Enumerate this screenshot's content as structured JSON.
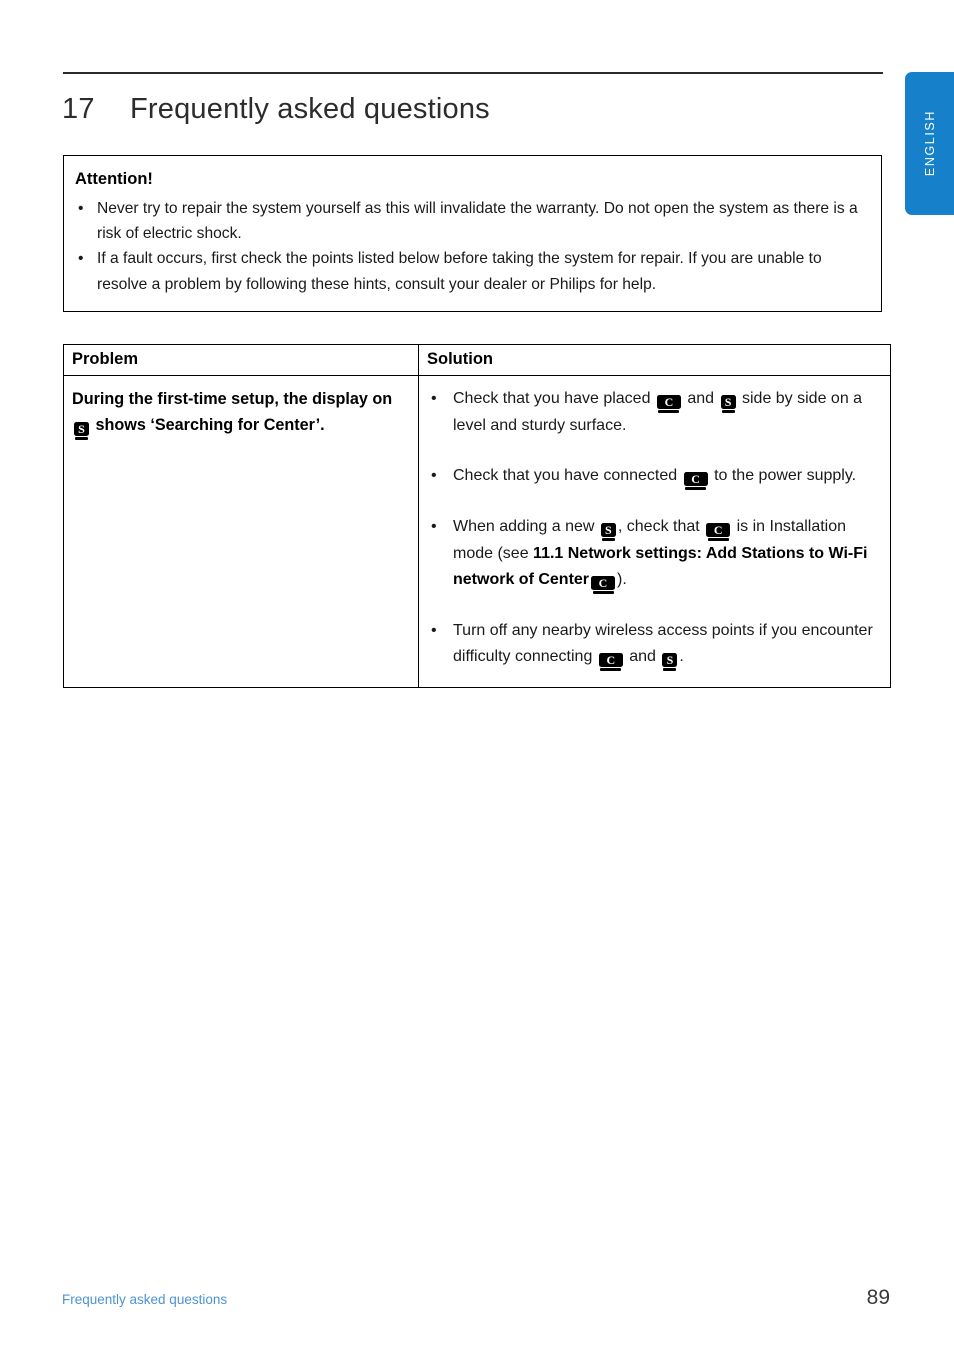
{
  "language_tab": {
    "label": "ENGLISH",
    "color": "#1680cb"
  },
  "chapter": {
    "number": "17",
    "title": "Frequently asked questions"
  },
  "attention": {
    "title": "Attention!",
    "bullet_marker": "•",
    "items": [
      "Never try to repair the system yourself as this will invalidate the warranty. Do not open the system as there is a risk of electric shock.",
      "If a fault occurs, first check the points listed below before taking the system for repair. If you are unable to resolve a problem by following these hints, consult your dealer or Philips for help."
    ]
  },
  "table": {
    "headers": {
      "problem": "Problem",
      "solution": "Solution"
    },
    "row": {
      "problem": {
        "part1": "During the first-time setup, the display on",
        "icon": "S",
        "part2": "shows ‘Searching for Center’."
      },
      "bullet_marker": "•",
      "solutions": [
        {
          "t1": "Check that you have placed",
          "i1": "C",
          "t2": "and",
          "i2": "S",
          "t3": "side by side on a level and sturdy surface."
        },
        {
          "t1": "Check that you have connected",
          "i1": "C",
          "t2": "to the power supply.",
          "i2": "",
          "t3": ""
        },
        {
          "t1": "When adding a new",
          "i1": "S",
          "t2": ", check that",
          "i2": "C",
          "t3": "is in Installation mode (see",
          "bold1": "11.1 Network settings: Add Stations to Wi-Fi network of Center",
          "i3": "C",
          "t4": ")."
        },
        {
          "t1": "Turn off any nearby wireless access points if you encounter difficulty connecting",
          "i1": "C",
          "t2": "and",
          "i2": "S",
          "t3": "."
        }
      ]
    }
  },
  "footer": {
    "left_text": "Frequently asked questions",
    "page_number": "89"
  }
}
